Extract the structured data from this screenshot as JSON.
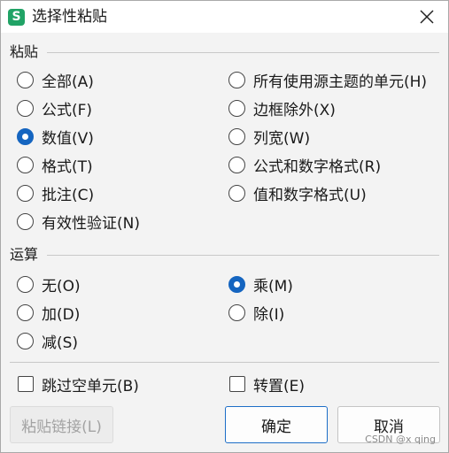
{
  "dialog": {
    "title": "选择性粘贴",
    "app_icon": "S"
  },
  "paste": {
    "section_label": "粘贴",
    "options": [
      {
        "label": "全部(A)",
        "checked": false
      },
      {
        "label": "所有使用源主题的单元(H)",
        "checked": false
      },
      {
        "label": "公式(F)",
        "checked": false
      },
      {
        "label": "边框除外(X)",
        "checked": false
      },
      {
        "label": "数值(V)",
        "checked": true
      },
      {
        "label": "列宽(W)",
        "checked": false
      },
      {
        "label": "格式(T)",
        "checked": false
      },
      {
        "label": "公式和数字格式(R)",
        "checked": false
      },
      {
        "label": "批注(C)",
        "checked": false
      },
      {
        "label": "值和数字格式(U)",
        "checked": false
      },
      {
        "label": "有效性验证(N)",
        "checked": false
      }
    ]
  },
  "operation": {
    "section_label": "运算",
    "options": [
      {
        "label": "无(O)",
        "checked": false
      },
      {
        "label": "乘(M)",
        "checked": true
      },
      {
        "label": "加(D)",
        "checked": false
      },
      {
        "label": "除(I)",
        "checked": false
      },
      {
        "label": "减(S)",
        "checked": false
      }
    ]
  },
  "checkboxes": {
    "skip_blanks": {
      "label": "跳过空单元(B)",
      "checked": false
    },
    "transpose": {
      "label": "转置(E)",
      "checked": false
    }
  },
  "buttons": {
    "paste_link": "粘贴链接(L)",
    "ok": "确定",
    "cancel": "取消"
  },
  "watermark": "CSDN @x qing",
  "colors": {
    "accent": "#1565c0",
    "app_icon": "#21a366"
  }
}
